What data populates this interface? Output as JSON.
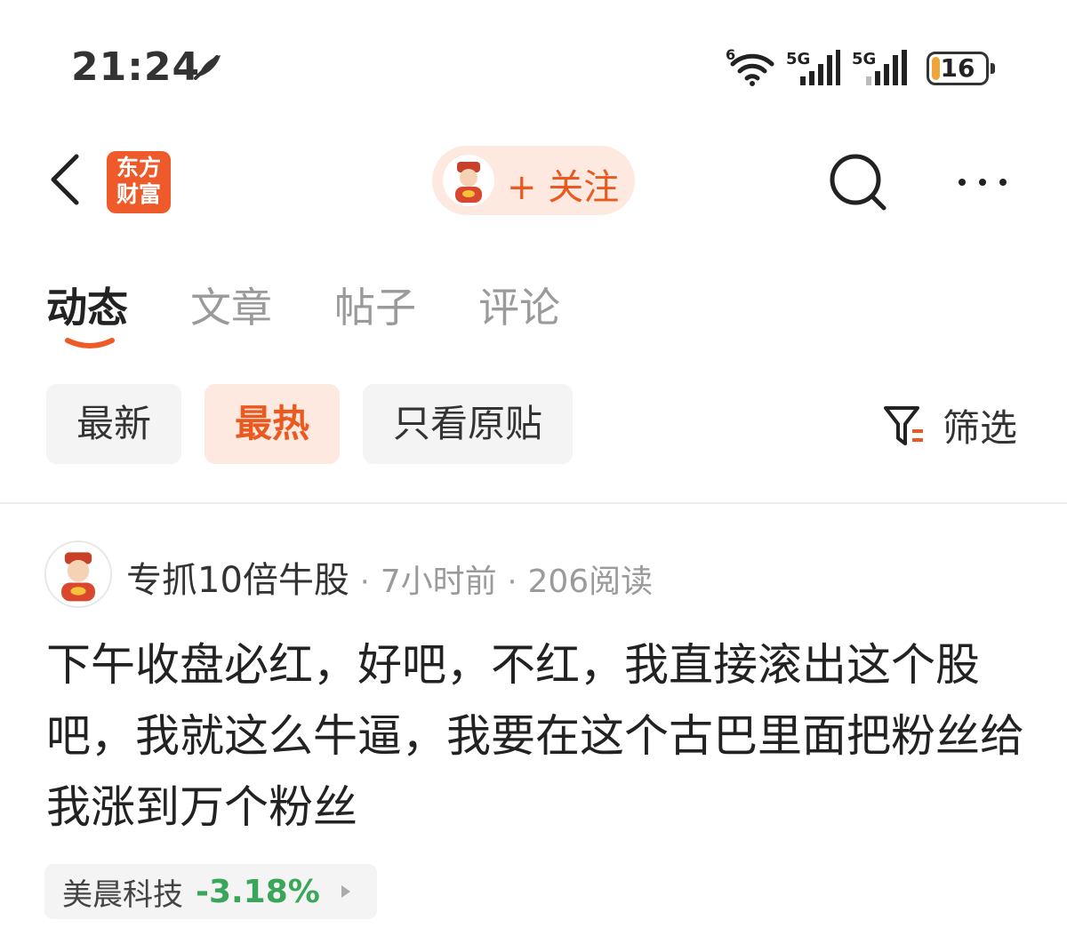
{
  "status_bar": {
    "time": "21:24",
    "wifi_badge": "6",
    "net1": "5G",
    "net2": "5G",
    "battery_level": "16",
    "battery_fraction": 0.16
  },
  "header": {
    "logo_line1": "东方",
    "logo_line2": "财富",
    "follow_label": "+ 关注"
  },
  "tabs": [
    {
      "label": "动态",
      "active": true
    },
    {
      "label": "文章",
      "active": false
    },
    {
      "label": "帖子",
      "active": false
    },
    {
      "label": "评论",
      "active": false
    }
  ],
  "chips": [
    {
      "label": "最新",
      "active": false
    },
    {
      "label": "最热",
      "active": true
    },
    {
      "label": "只看原贴",
      "active": false
    }
  ],
  "filter_label": "筛选",
  "post": {
    "username": "专抓10倍牛股",
    "time_ago": "7小时前",
    "reads": "206阅读",
    "body": "下午收盘必红，好吧，不红，我直接滚出这个股吧，我就这么牛逼，我要在这个古巴里面把粉丝给我涨到万个粉丝",
    "stock": {
      "name": "美晨科技",
      "change": "-3.18%"
    }
  },
  "colors": {
    "accent": "#ea5a20",
    "accent_bg": "#fde9df",
    "down_green": "#3aa65a",
    "logo_red": "#ef5a2b"
  }
}
